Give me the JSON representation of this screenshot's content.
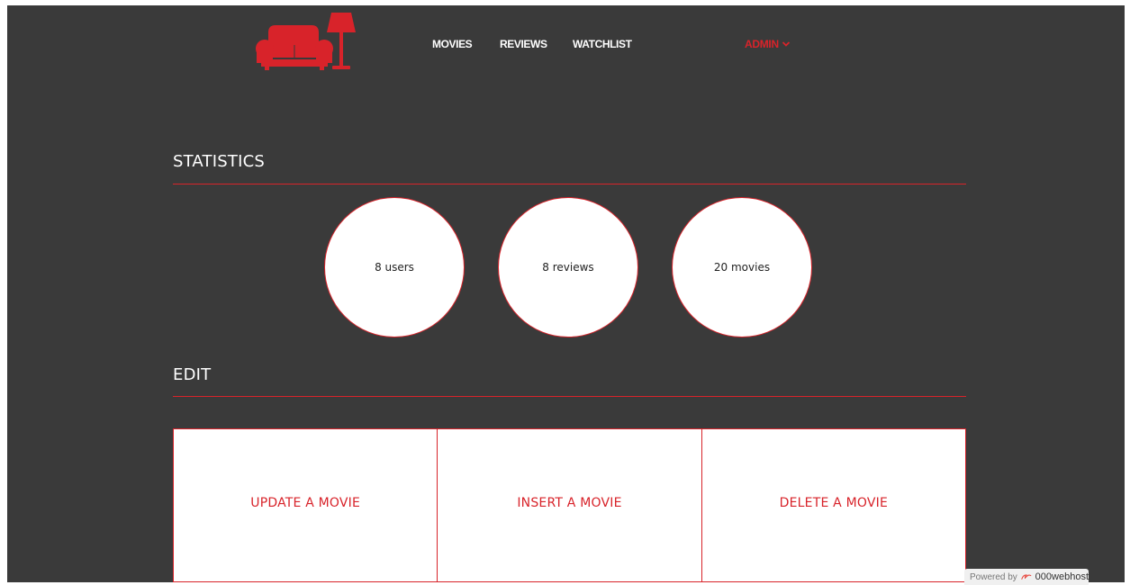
{
  "nav": {
    "items": [
      {
        "label": "MOVIES"
      },
      {
        "label": "REVIEWS"
      },
      {
        "label": "WATCHLIST"
      }
    ],
    "admin_label": "ADMIN"
  },
  "statistics": {
    "title": "STATISTICS",
    "items": [
      {
        "label": "8 users"
      },
      {
        "label": "8 reviews"
      },
      {
        "label": "20 movies"
      }
    ]
  },
  "edit": {
    "title": "EDIT",
    "actions": [
      {
        "label": "UPDATE A MOVIE"
      },
      {
        "label": "INSERT A MOVIE"
      },
      {
        "label": "DELETE A MOVIE"
      }
    ]
  },
  "footer": {
    "powered_by": "Powered by",
    "brand": "000webhost"
  },
  "colors": {
    "background": "#3a3a3a",
    "accent": "#d8232a",
    "text_light": "#ffffff"
  },
  "icons": {
    "logo": "sofa-lamp-icon",
    "dropdown": "chevron-down-icon",
    "host": "webhost-logo-icon"
  }
}
